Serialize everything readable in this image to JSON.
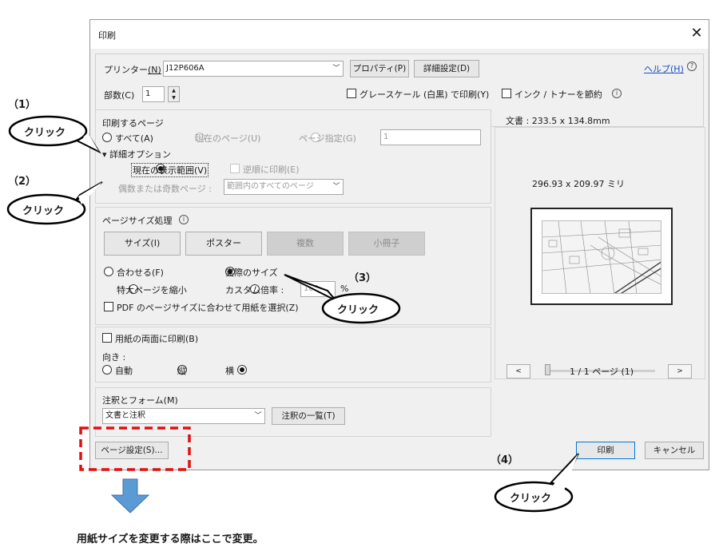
{
  "dialog": {
    "title": "印刷",
    "close_glyph": "✕",
    "printer_label": "プリンター",
    "printer_key": "(N)",
    "printer_value": "J12P606A",
    "properties_button": "プロパティ(P)",
    "advanced_button": "詳細設定(D)",
    "help_link": "ヘルプ(H)",
    "copies_label": "部数(C)",
    "copies_value": "1",
    "grayscale_label": "グレースケール (白黒) で印刷(Y)",
    "save_ink_label": "インク / トナーを節約"
  },
  "pages": {
    "heading": "印刷するページ",
    "all": "すべて(A)",
    "current": "現在のページ(U)",
    "specify": "ページ指定(G)",
    "range_value": "1",
    "more_options": "詳細オプション",
    "current_view": "現在の表示範囲(V)",
    "reverse": "逆順に印刷(E)",
    "odd_even_label": "偶数または奇数ページ :",
    "odd_even_value": "範囲内のすべてのページ"
  },
  "sizing": {
    "heading": "ページサイズ処理",
    "size_btn": "サイズ(I)",
    "poster_btn": "ポスター",
    "multiple_btn": "複数",
    "booklet_btn": "小冊子",
    "fit": "合わせる(F)",
    "actual": "実際のサイズ",
    "shrink": "特大ページを縮小",
    "custom": "カスタム倍率 :",
    "custom_value": "100",
    "percent": "%",
    "pdf_paper": "PDF のページサイズに合わせて用紙を選択(Z)"
  },
  "duplex": {
    "both_sides": "用紙の両面に印刷(B)",
    "orientation_label": "向き :",
    "auto": "自動",
    "portrait": "縦",
    "landscape": "横"
  },
  "comments": {
    "heading": "注釈とフォーム(M)",
    "value": "文書と注釈",
    "summary_btn": "注釈の一覧(T)"
  },
  "footer": {
    "page_setup_btn": "ページ設定(S)...",
    "print_btn": "印刷",
    "cancel_btn": "キャンセル"
  },
  "preview": {
    "doc_size": "文書 : 233.5 x 134.8mm",
    "paper_size": "296.93 x 209.97 ミリ",
    "page_counter": "1 / 1 ページ (1)",
    "prev": "<",
    "next": ">"
  },
  "annotations": {
    "step1": "（1）",
    "step2": "（2）",
    "step3": "（3）",
    "step4": "（4）",
    "click": "クリック",
    "note": "用紙サイズを変更する際はここで変更。"
  }
}
